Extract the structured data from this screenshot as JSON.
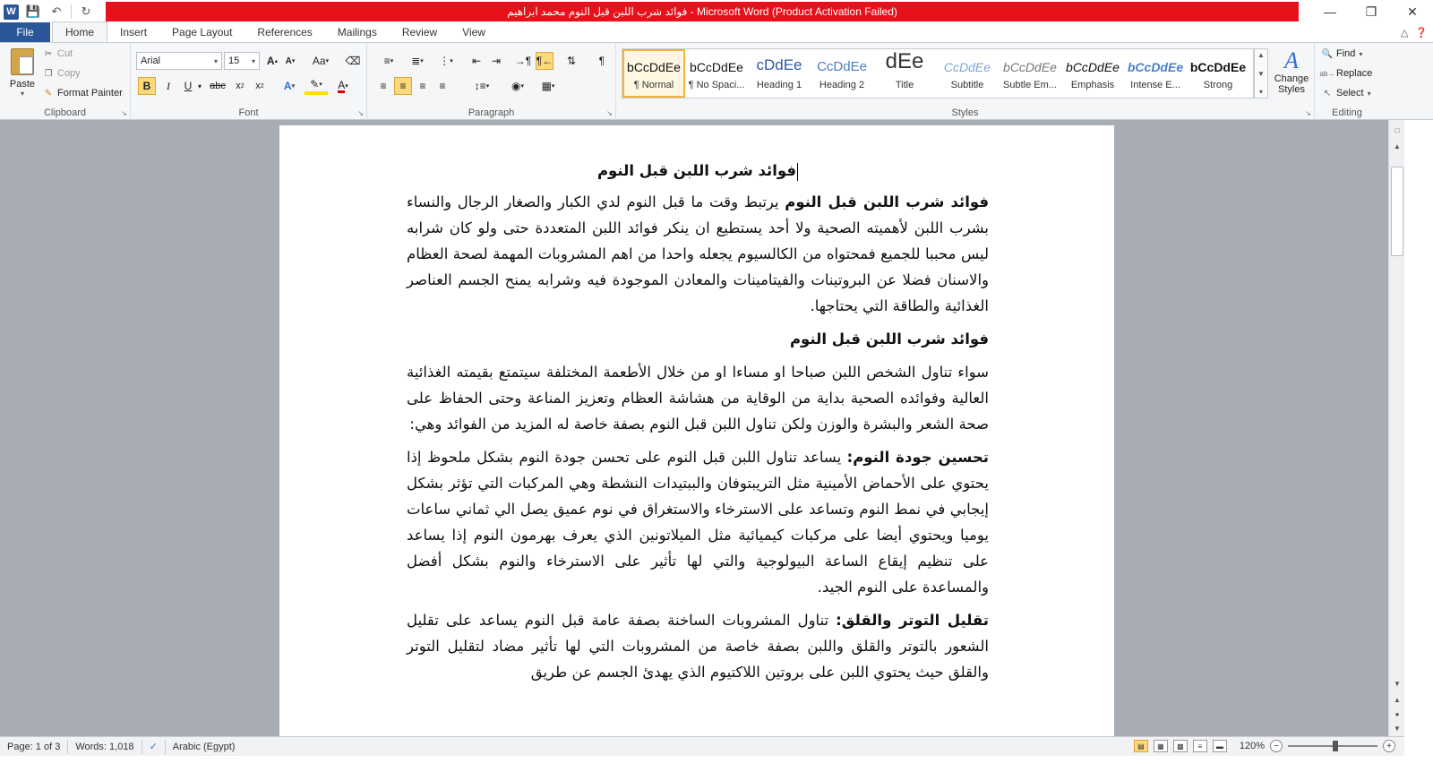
{
  "titlebar": {
    "title": "فوائد شرب اللبن قبل النوم محمد ابراهيم  -  Microsoft Word (Product Activation Failed)",
    "logo": "W"
  },
  "tabs": [
    "File",
    "Home",
    "Insert",
    "Page Layout",
    "References",
    "Mailings",
    "Review",
    "View"
  ],
  "clipboard": {
    "paste": "Paste",
    "cut": "Cut",
    "copy": "Copy",
    "format_painter": "Format Painter",
    "group": "Clipboard"
  },
  "font": {
    "name": "Arial",
    "size": "15",
    "group": "Font"
  },
  "paragraph": {
    "group": "Paragraph"
  },
  "styles": {
    "group": "Styles",
    "items": [
      {
        "preview": "bCcDdEe",
        "name": "¶ Normal"
      },
      {
        "preview": "bCcDdEe",
        "name": "¶ No Spaci..."
      },
      {
        "preview": "cDdEe",
        "name": "Heading 1"
      },
      {
        "preview": "CcDdEe",
        "name": "Heading 2"
      },
      {
        "preview": "dEe",
        "name": "Title"
      },
      {
        "preview": "CcDdEe",
        "name": "Subtitle"
      },
      {
        "preview": "bCcDdEe",
        "name": "Subtle Em..."
      },
      {
        "preview": "bCcDdEe",
        "name": "Emphasis"
      },
      {
        "preview": "bCcDdEe",
        "name": "Intense E..."
      },
      {
        "preview": "bCcDdEe",
        "name": "Strong"
      }
    ],
    "change_styles": "Change Styles"
  },
  "editing": {
    "group": "Editing",
    "find": "Find",
    "replace": "Replace",
    "select": "Select"
  },
  "document": {
    "title": "فوائد شرب اللبن قبل النوم",
    "p1_bold": "فوائد شرب اللبن قبل النوم",
    "p1_text": " يرتبط وقت ما قبل النوم لدي الكبار والصغار الرجال والنساء بشرب اللبن لأهميته الصحية ولا أحد يستطيع ان ينكر فوائد اللبن المتعددة حتى ولو كان شرابه ليس محببا للجميع فمحتواه من الكالسيوم يجعله واحدا من اهم المشروبات المهمة لصحة العظام والاسنان فضلا عن البروتينات والفيتامينات والمعادن الموجودة فيه وشرابه يمنح الجسم العناصر الغذائية والطاقة التي يحتاجها.",
    "h2": "فوائد شرب اللبن قبل النوم",
    "p2": "سواء تناول الشخص اللبن صباحا او مساءا او من خلال الأطعمة المختلفة سيتمتع بقيمته الغذائية العالية وفوائده الصحية بداية من الوقاية من هشاشة العظام وتعزيز المناعة وحتى الحفاظ على صحة الشعر والبشرة والوزن ولكن تناول اللبن قبل النوم بصفة خاصة له المزيد من الفوائد وهي:",
    "p3_bold": "تحسين جودة النوم:",
    "p3_text": " يساعد تناول اللبن قبل النوم على تحسن جودة النوم بشكل ملحوظ إذا يحتوي على الأحماض الأمينية مثل التريبتوفان والببتيدات النشطة وهي المركبات التي تؤثر بشكل إيجابي في نمط النوم وتساعد على الاسترخاء والاستغراق في نوم عميق يصل الي ثماني ساعات يوميا ويحتوي أيضا على مركبات كيميائية مثل الميلاتونين الذي يعرف بهرمون النوم إذا يساعد على تنظيم إيقاع الساعة البيولوجية والتي لها تأثير على الاسترخاء والنوم بشكل أفضل والمساعدة على النوم الجيد.",
    "p4_bold": "تقليل التوتر والقلق:",
    "p4_text": " تناول المشروبات الساخنة بصفة عامة قبل النوم يساعد على تقليل الشعور بالتوتر والقلق واللبن بصفة خاصة من المشروبات التي لها تأثير مضاد لتقليل التوتر والقلق حيث يحتوي اللبن على بروتين اللاكتيوم الذي يهدئ الجسم عن طريق"
  },
  "status": {
    "page": "Page: 1 of 3",
    "words": "Words: 1,018",
    "language": "Arabic (Egypt)",
    "zoom": "120%",
    "zoom_value": 120
  }
}
